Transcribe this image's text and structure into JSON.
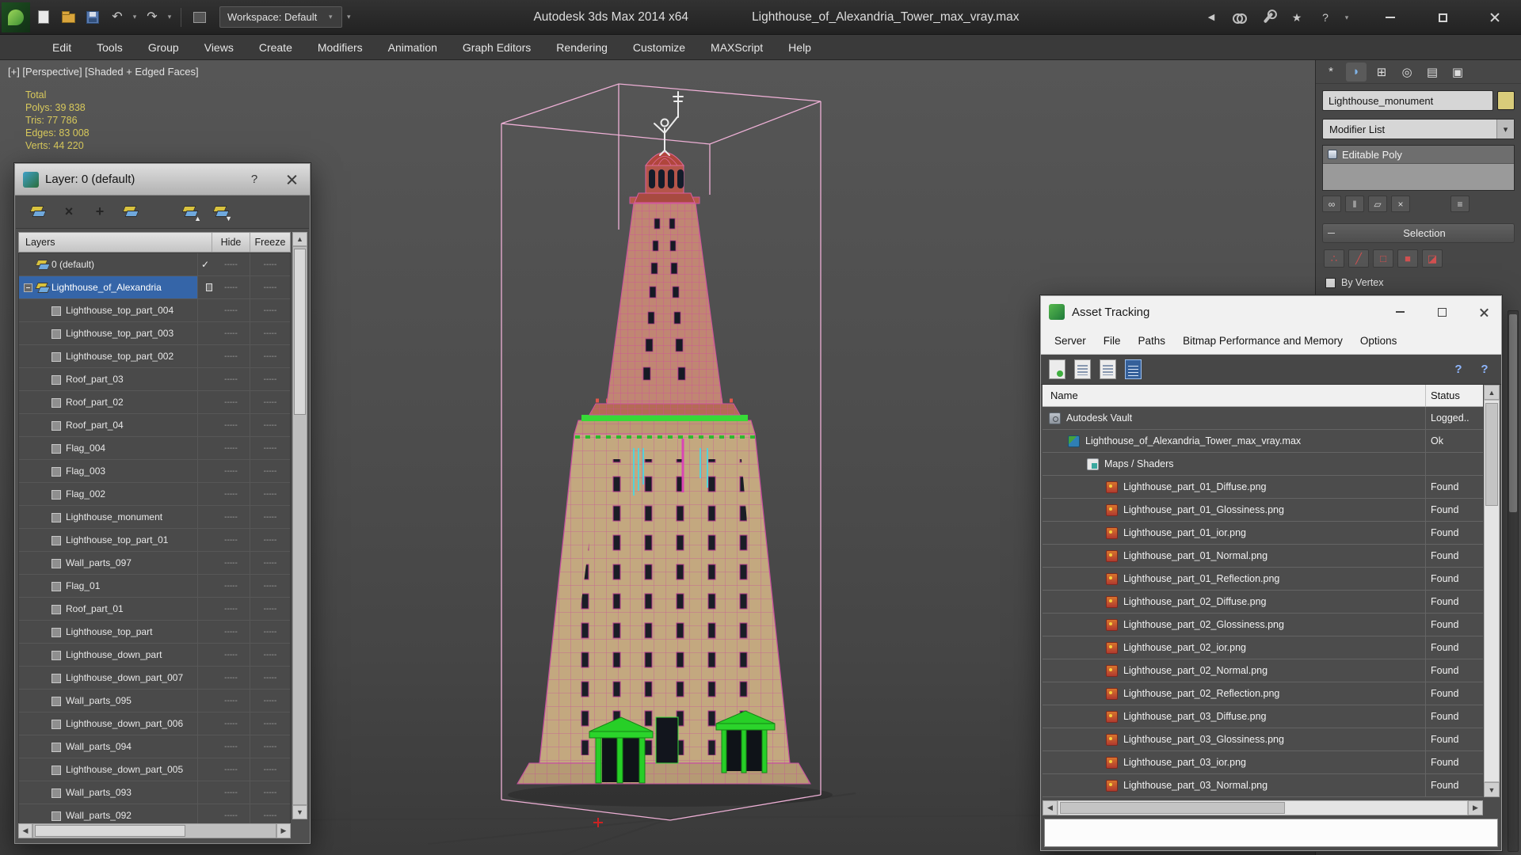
{
  "colors": {
    "selection_blue": "#3565a8",
    "wireframe_magenta": "#c8439b",
    "highlight_green": "#2bd42b",
    "stats_yellow": "#d8c95c"
  },
  "titlebar": {
    "workspace": "Workspace: Default",
    "app_title": "Autodesk 3ds Max  2014 x64",
    "document_title": "Lighthouse_of_Alexandria_Tower_max_vray.max"
  },
  "menubar": {
    "items": [
      "Edit",
      "Tools",
      "Group",
      "Views",
      "Create",
      "Modifiers",
      "Animation",
      "Graph Editors",
      "Rendering",
      "Customize",
      "MAXScript",
      "Help"
    ]
  },
  "viewport": {
    "label": "[+] [Perspective] [Shaded + Edged Faces]",
    "stats": [
      "Total",
      "Polys:  39 838",
      "Tris:  77 786",
      "Edges:  83 008",
      "Verts:  44 220"
    ]
  },
  "layer_dialog": {
    "title": "Layer: 0 (default)",
    "columns": {
      "layers": "Layers",
      "hide": "Hide",
      "freeze": "Freeze"
    },
    "cell_marker": "-----",
    "current_marker": "✓",
    "rows": [
      {
        "name": "0 (default)",
        "icon": "layer",
        "level": 0,
        "current": true
      },
      {
        "name": "Lighthouse_of_Alexandria",
        "icon": "layer",
        "level": 0,
        "selected": true,
        "expander": true,
        "marker": true
      },
      {
        "name": "Lighthouse_top_part_004",
        "icon": "object",
        "level": 1
      },
      {
        "name": "Lighthouse_top_part_003",
        "icon": "object",
        "level": 1
      },
      {
        "name": "Lighthouse_top_part_002",
        "icon": "object",
        "level": 1
      },
      {
        "name": "Roof_part_03",
        "icon": "object",
        "level": 1
      },
      {
        "name": "Roof_part_02",
        "icon": "object",
        "level": 1
      },
      {
        "name": "Roof_part_04",
        "icon": "object",
        "level": 1
      },
      {
        "name": "Flag_004",
        "icon": "object",
        "level": 1
      },
      {
        "name": "Flag_003",
        "icon": "object",
        "level": 1
      },
      {
        "name": "Flag_002",
        "icon": "object",
        "level": 1
      },
      {
        "name": "Lighthouse_monument",
        "icon": "object",
        "level": 1
      },
      {
        "name": "Lighthouse_top_part_01",
        "icon": "object",
        "level": 1
      },
      {
        "name": "Wall_parts_097",
        "icon": "object",
        "level": 1
      },
      {
        "name": "Flag_01",
        "icon": "object",
        "level": 1
      },
      {
        "name": "Roof_part_01",
        "icon": "object",
        "level": 1
      },
      {
        "name": "Lighthouse_top_part",
        "icon": "object",
        "level": 1
      },
      {
        "name": "Lighthouse_down_part",
        "icon": "object",
        "level": 1
      },
      {
        "name": "Lighthouse_down_part_007",
        "icon": "object",
        "level": 1
      },
      {
        "name": "Wall_parts_095",
        "icon": "object",
        "level": 1
      },
      {
        "name": "Lighthouse_down_part_006",
        "icon": "object",
        "level": 1
      },
      {
        "name": "Wall_parts_094",
        "icon": "object",
        "level": 1
      },
      {
        "name": "Lighthouse_down_part_005",
        "icon": "object",
        "level": 1
      },
      {
        "name": "Wall_parts_093",
        "icon": "object",
        "level": 1
      },
      {
        "name": "Wall_parts_092",
        "icon": "object",
        "level": 1
      }
    ]
  },
  "asset_tracking": {
    "title": "Asset Tracking",
    "menu": [
      "Server",
      "File",
      "Paths",
      "Bitmap Performance and Memory",
      "Options"
    ],
    "columns": {
      "name": "Name",
      "status": "Status"
    },
    "rows": [
      {
        "name": "Autodesk Vault",
        "status": "Logged..",
        "icon": "vault",
        "level": 0
      },
      {
        "name": "Lighthouse_of_Alexandria_Tower_max_vray.max",
        "status": "Ok",
        "icon": "maxfile",
        "level": 1
      },
      {
        "name": "Maps / Shaders",
        "status": "",
        "icon": "maps",
        "level": 2
      },
      {
        "name": "Lighthouse_part_01_Diffuse.png",
        "status": "Found",
        "icon": "bitmap",
        "level": 3
      },
      {
        "name": "Lighthouse_part_01_Glossiness.png",
        "status": "Found",
        "icon": "bitmap",
        "level": 3
      },
      {
        "name": "Lighthouse_part_01_ior.png",
        "status": "Found",
        "icon": "bitmap",
        "level": 3
      },
      {
        "name": "Lighthouse_part_01_Normal.png",
        "status": "Found",
        "icon": "bitmap",
        "level": 3
      },
      {
        "name": "Lighthouse_part_01_Reflection.png",
        "status": "Found",
        "icon": "bitmap",
        "level": 3
      },
      {
        "name": "Lighthouse_part_02_Diffuse.png",
        "status": "Found",
        "icon": "bitmap",
        "level": 3
      },
      {
        "name": "Lighthouse_part_02_Glossiness.png",
        "status": "Found",
        "icon": "bitmap",
        "level": 3
      },
      {
        "name": "Lighthouse_part_02_ior.png",
        "status": "Found",
        "icon": "bitmap",
        "level": 3
      },
      {
        "name": "Lighthouse_part_02_Normal.png",
        "status": "Found",
        "icon": "bitmap",
        "level": 3
      },
      {
        "name": "Lighthouse_part_02_Reflection.png",
        "status": "Found",
        "icon": "bitmap",
        "level": 3
      },
      {
        "name": "Lighthouse_part_03_Diffuse.png",
        "status": "Found",
        "icon": "bitmap",
        "level": 3
      },
      {
        "name": "Lighthouse_part_03_Glossiness.png",
        "status": "Found",
        "icon": "bitmap",
        "level": 3
      },
      {
        "name": "Lighthouse_part_03_ior.png",
        "status": "Found",
        "icon": "bitmap",
        "level": 3
      },
      {
        "name": "Lighthouse_part_03_Normal.png",
        "status": "Found",
        "icon": "bitmap",
        "level": 3
      }
    ]
  },
  "command_panel": {
    "object_name": "Lighthouse_monument",
    "modifier_list": "Modifier List",
    "stack": [
      "Editable Poly"
    ],
    "selection_rollout": {
      "title": "Selection",
      "by_vertex": "By Vertex"
    }
  },
  "icons": {
    "undo": "↶",
    "redo": "↷",
    "dropdown": "▾",
    "back": "◀",
    "star": "★",
    "help": "?",
    "scroll_up": "▲",
    "scroll_down": "▼",
    "scroll_left": "◀",
    "scroll_right": "▶",
    "delete_layer": "×",
    "add_layer": "+",
    "tabs": [
      "*",
      "◗",
      "⊞",
      "◎",
      "▤",
      "▣"
    ],
    "stack_tools": [
      "∞",
      "‖",
      "▱",
      "×",
      "≡"
    ],
    "subobject": [
      "∴",
      "╱",
      "□",
      "■",
      "◪"
    ]
  }
}
